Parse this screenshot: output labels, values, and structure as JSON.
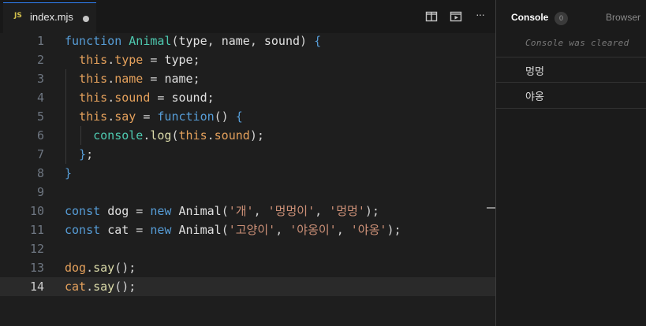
{
  "editor": {
    "tab": {
      "badge": "JS",
      "filename": "index.mjs"
    },
    "toolbar": {
      "split_icon": "split-editor-icon",
      "preview_icon": "run-preview-icon",
      "more_icon": "more-actions-icon",
      "more_label": "···"
    },
    "active_line": 14,
    "lines": [
      {
        "n": "1",
        "tokens": [
          [
            "kw",
            "function "
          ],
          [
            "cls",
            "Animal"
          ],
          [
            "pun",
            "("
          ],
          [
            "var",
            "type"
          ],
          [
            "pun",
            ", "
          ],
          [
            "var",
            "name"
          ],
          [
            "pun",
            ", "
          ],
          [
            "var",
            "sound"
          ],
          [
            "pun",
            ") "
          ],
          [
            "kw",
            "{"
          ]
        ]
      },
      {
        "n": "2",
        "tokens": [
          [
            "pun",
            "  "
          ],
          [
            "th",
            "this"
          ],
          [
            "pun",
            "."
          ],
          [
            "prop",
            "type"
          ],
          [
            "pun",
            " = "
          ],
          [
            "var",
            "type"
          ],
          [
            "pun",
            ";"
          ]
        ]
      },
      {
        "n": "3",
        "tokens": [
          [
            "pun",
            "  "
          ],
          [
            "th",
            "this"
          ],
          [
            "pun",
            "."
          ],
          [
            "prop",
            "name"
          ],
          [
            "pun",
            " = "
          ],
          [
            "var",
            "name"
          ],
          [
            "pun",
            ";"
          ]
        ]
      },
      {
        "n": "4",
        "tokens": [
          [
            "pun",
            "  "
          ],
          [
            "th",
            "this"
          ],
          [
            "pun",
            "."
          ],
          [
            "prop",
            "sound"
          ],
          [
            "pun",
            " = "
          ],
          [
            "var",
            "sound"
          ],
          [
            "pun",
            ";"
          ]
        ]
      },
      {
        "n": "5",
        "tokens": [
          [
            "pun",
            "  "
          ],
          [
            "th",
            "this"
          ],
          [
            "pun",
            "."
          ],
          [
            "prop",
            "say"
          ],
          [
            "pun",
            " = "
          ],
          [
            "kw",
            "function"
          ],
          [
            "pun",
            "() "
          ],
          [
            "kw",
            "{"
          ]
        ]
      },
      {
        "n": "6",
        "tokens": [
          [
            "pun",
            "    "
          ],
          [
            "cls",
            "console"
          ],
          [
            "pun",
            "."
          ],
          [
            "fn",
            "log"
          ],
          [
            "pun",
            "("
          ],
          [
            "th",
            "this"
          ],
          [
            "pun",
            "."
          ],
          [
            "prop",
            "sound"
          ],
          [
            "pun",
            ");"
          ]
        ]
      },
      {
        "n": "7",
        "tokens": [
          [
            "pun",
            "  "
          ],
          [
            "kw",
            "}"
          ],
          [
            "pun",
            ";"
          ]
        ]
      },
      {
        "n": "8",
        "tokens": [
          [
            "kw",
            "}"
          ]
        ]
      },
      {
        "n": "9",
        "tokens": []
      },
      {
        "n": "10",
        "tokens": [
          [
            "kw",
            "const "
          ],
          [
            "var",
            "dog"
          ],
          [
            "pun",
            " = "
          ],
          [
            "kw",
            "new "
          ],
          [
            "var",
            "Animal"
          ],
          [
            "pun",
            "("
          ],
          [
            "str",
            "'개'"
          ],
          [
            "pun",
            ", "
          ],
          [
            "str",
            "'멍멍이'"
          ],
          [
            "pun",
            ", "
          ],
          [
            "str",
            "'멍멍'"
          ],
          [
            "pun",
            ");"
          ]
        ]
      },
      {
        "n": "11",
        "tokens": [
          [
            "kw",
            "const "
          ],
          [
            "var",
            "cat"
          ],
          [
            "pun",
            " = "
          ],
          [
            "kw",
            "new "
          ],
          [
            "var",
            "Animal"
          ],
          [
            "pun",
            "("
          ],
          [
            "str",
            "'고양이'"
          ],
          [
            "pun",
            ", "
          ],
          [
            "str",
            "'야옹이'"
          ],
          [
            "pun",
            ", "
          ],
          [
            "str",
            "'야옹'"
          ],
          [
            "pun",
            ");"
          ]
        ]
      },
      {
        "n": "12",
        "tokens": []
      },
      {
        "n": "13",
        "tokens": [
          [
            "th",
            "dog"
          ],
          [
            "pun",
            "."
          ],
          [
            "fn",
            "say"
          ],
          [
            "pun",
            "();"
          ]
        ]
      },
      {
        "n": "14",
        "tokens": [
          [
            "th",
            "cat"
          ],
          [
            "pun",
            "."
          ],
          [
            "fn",
            "say"
          ],
          [
            "pun",
            "();"
          ]
        ]
      }
    ]
  },
  "console": {
    "title": "Console",
    "count": "0",
    "browser_tab": "Browser",
    "cleared_message": "Console was cleared",
    "entries": [
      "멍멍",
      "야옹"
    ]
  },
  "colors": {
    "kw": "#569cd6",
    "cls": "#4ec9b0",
    "fn": "#dcdcaa",
    "this": "#e5a15c",
    "string": "#ce9178"
  }
}
